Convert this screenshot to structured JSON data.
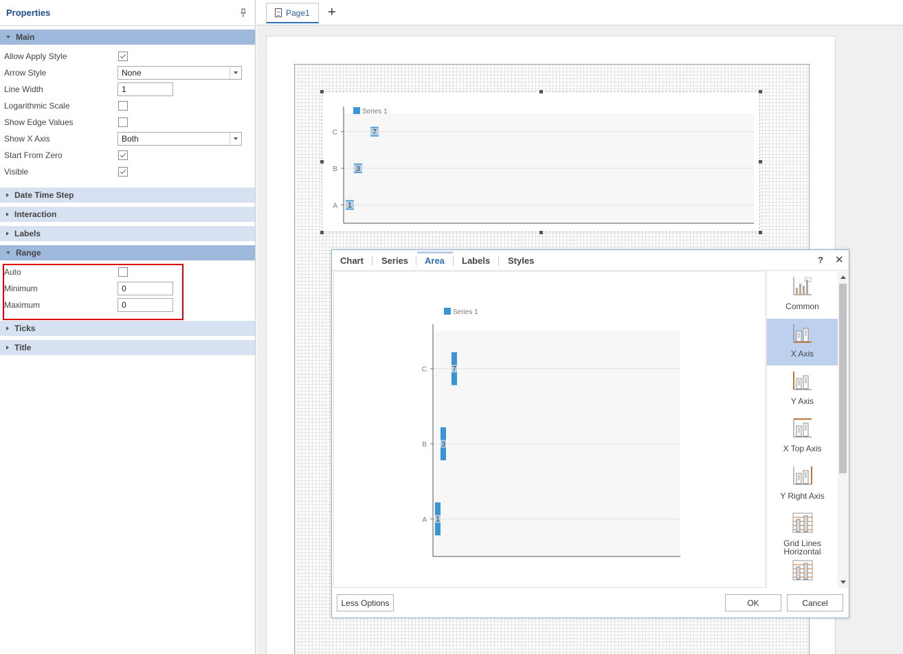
{
  "properties": {
    "title": "Properties",
    "sections": {
      "main": "Main",
      "date_time_step": "Date Time Step",
      "interaction": "Interaction",
      "labels": "Labels",
      "range": "Range",
      "ticks": "Ticks",
      "title": "Title"
    },
    "main_rows": {
      "allow_apply_style": {
        "label": "Allow Apply Style",
        "checked": true
      },
      "arrow_style": {
        "label": "Arrow Style",
        "value": "None"
      },
      "line_width": {
        "label": "Line Width",
        "value": "1"
      },
      "logarithmic_scale": {
        "label": "Logarithmic Scale",
        "checked": false
      },
      "show_edge_values": {
        "label": "Show Edge Values",
        "checked": false
      },
      "show_x_axis": {
        "label": "Show X Axis",
        "value": "Both"
      },
      "start_from_zero": {
        "label": "Start From Zero",
        "checked": true
      },
      "visible": {
        "label": "Visible",
        "checked": true
      }
    },
    "range_rows": {
      "auto": {
        "label": "Auto",
        "checked": false
      },
      "minimum": {
        "label": "Minimum",
        "value": "0"
      },
      "maximum": {
        "label": "Maximum",
        "value": "0"
      }
    }
  },
  "tabs": {
    "page1": "Page1",
    "add": "+"
  },
  "dialog": {
    "tabs": [
      "Chart",
      "Series",
      "Area",
      "Labels",
      "Styles"
    ],
    "active_tab": "Area",
    "help": "?",
    "close": "✕",
    "sidebar": [
      {
        "label": "Common",
        "icon": "common-chart-icon"
      },
      {
        "label": "X Axis",
        "icon": "x-axis-icon",
        "selected": true
      },
      {
        "label": "Y Axis",
        "icon": "y-axis-icon"
      },
      {
        "label": "X Top Axis",
        "icon": "x-top-axis-icon"
      },
      {
        "label": "Y Right Axis",
        "icon": "y-right-axis-icon"
      },
      {
        "label": "Grid Lines Horizontal",
        "label_line1": "Grid Lines",
        "label_line2": "Horizontal",
        "icon": "grid-lines-horizontal-icon"
      },
      {
        "label": "",
        "icon": "grid-lines-vertical-icon"
      }
    ],
    "buttons": {
      "less_options": "Less Options",
      "ok": "OK",
      "cancel": "Cancel"
    }
  },
  "chart_data": {
    "type": "bar",
    "orientation": "horizontal",
    "categories": [
      "A",
      "B",
      "C"
    ],
    "series": [
      {
        "name": "Series 1",
        "values": [
          1,
          3,
          7
        ]
      }
    ],
    "data_labels": [
      "1",
      "3",
      "7"
    ],
    "legend": "top-left",
    "color": "#3a95d7"
  },
  "colors": {
    "accent": "#2b6fb6",
    "section_header": "#d6e1f1",
    "section_header_open": "#9fb9dc",
    "highlight": "#e00000",
    "bar": "#3a95d7"
  }
}
